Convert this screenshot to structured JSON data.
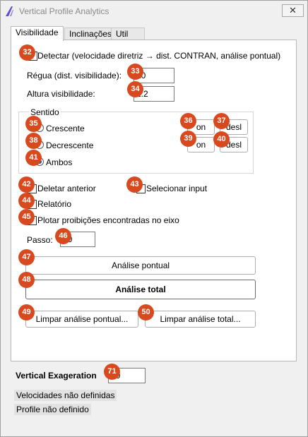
{
  "window": {
    "title": "Vertical Profile Analytics",
    "close_glyph": "✕"
  },
  "tabs": [
    "Visibilidade",
    "Inclinações",
    "Util"
  ],
  "detectar": {
    "label": "Detectar (velocidade diretriz → dist. CONTRAN, análise pontual)"
  },
  "regua": {
    "label": "Régua (dist. visibilidade):",
    "value": "20"
  },
  "altura": {
    "label": "Altura visibilidade:",
    "value": "1.2"
  },
  "sentido": {
    "title": "Sentido",
    "crescente": "Crescente",
    "decrescente": "Decrescente",
    "ambos": "Ambos",
    "on_label": "on",
    "desl_label": "desl"
  },
  "options": {
    "deletar": "Deletar anterior",
    "selecionar": "Selecionar input",
    "relatorio": "Relatório",
    "plotar": "Plotar proibições encontradas no eixo"
  },
  "passo": {
    "label": "Passo:",
    "value": "10"
  },
  "buttons": {
    "analise_pontual": "Análise pontual",
    "analise_total": "Análise total",
    "limpar_pontual": "Limpar análise pontual...",
    "limpar_total": "Limpar análise total..."
  },
  "vertical": {
    "label": "Vertical Exageration",
    "value": "10"
  },
  "status": {
    "velocidades": "Velocidades não definidas",
    "profile": "Profile não definido"
  },
  "badges": [
    "32",
    "33",
    "34",
    "35",
    "36",
    "37",
    "38",
    "39",
    "40",
    "41",
    "42",
    "43",
    "44",
    "45",
    "46",
    "47",
    "48",
    "49",
    "50",
    "71"
  ],
  "colors": {
    "badge": "#d9491f",
    "radio_dot": "#1a4fb5",
    "status_bg": "#e2e2e2"
  }
}
